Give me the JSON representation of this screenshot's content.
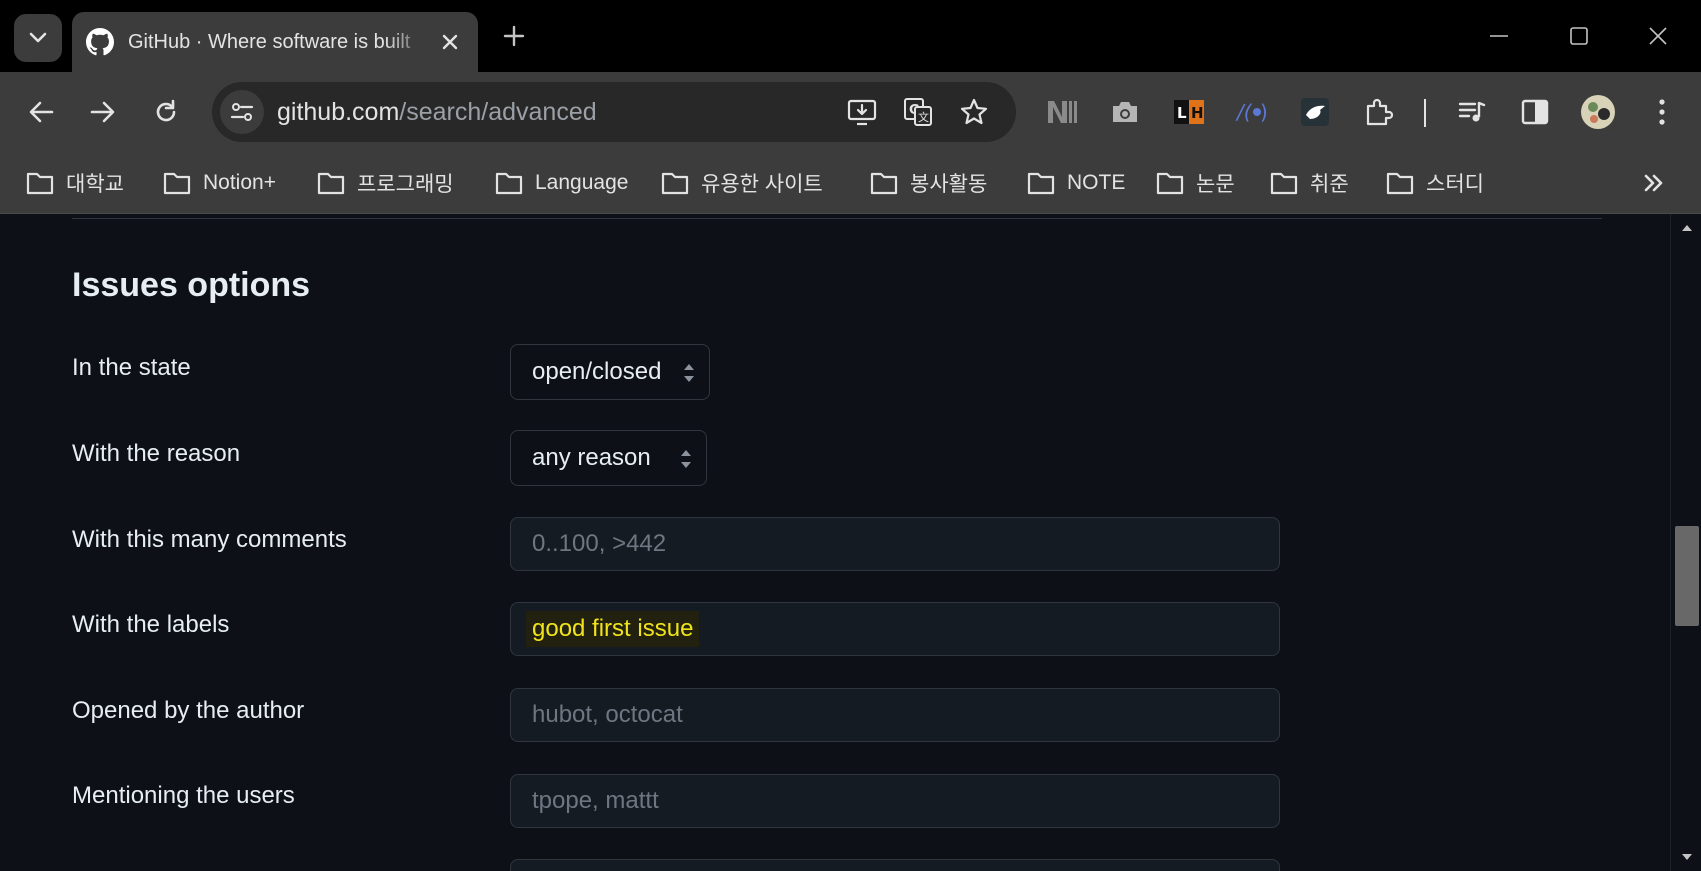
{
  "browser": {
    "tab_title": "GitHub · Where software is built",
    "url_host": "github.com",
    "url_path": "/search/advanced",
    "bookmarks": [
      "대학교",
      "Notion+",
      "프로그래밍",
      "Language",
      "유용한 사이트",
      "봉사활동",
      "NOTE",
      "논문",
      "취준",
      "스터디"
    ],
    "extensions": [
      "notion-web-clipper-icon",
      "camera-icon",
      "lh-icon",
      "wappalyzer-icon",
      "bird-icon",
      "extensions-puzzle-icon",
      "media-playlist-icon",
      "side-panel-icon",
      "profile-avatar"
    ]
  },
  "issues_options": {
    "title": "Issues options",
    "state_label": "In the state",
    "state_value": "open/closed",
    "reason_label": "With the reason",
    "reason_value": "any reason",
    "comments_label": "With this many comments",
    "comments_placeholder": "0..100, >442",
    "labels_label": "With the labels",
    "labels_value": "good first issue",
    "author_label": "Opened by the author",
    "author_placeholder": "hubot, octocat",
    "mention_label": "Mentioning the users",
    "mention_placeholder": "tpope, mattt"
  },
  "colors": {
    "page_bg": "#0d1117",
    "chrome_bg": "#3c3c3c",
    "highlight_text": "#f0e31c"
  }
}
